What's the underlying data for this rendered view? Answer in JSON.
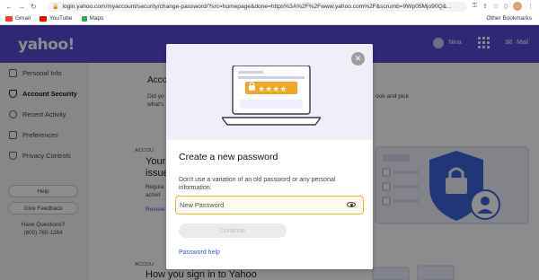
{
  "browser": {
    "url": "login.yahoo.com/myaccount/security/change-password/?src=homepage&done=https%3A%2F%2Fwww.yahoo.com%2F&scrumb=9Wp05Mjo90Q&..."
  },
  "bookmarks": {
    "items": [
      "Gmail",
      "YouTube",
      "Maps"
    ],
    "other": "Other Bookmarks"
  },
  "header": {
    "logo": "yahoo!",
    "user": "Nina",
    "mail": "Mail"
  },
  "sidebar": {
    "items": [
      {
        "label": "Personal Info",
        "active": false
      },
      {
        "label": "Account Security",
        "active": true
      },
      {
        "label": "Recent Activity",
        "active": false
      },
      {
        "label": "Preferences",
        "active": false
      },
      {
        "label": "Privacy Controls",
        "active": false
      }
    ],
    "help": "Help",
    "feedback": "Give Feedback",
    "questions": "Have Questions?",
    "phone": "(800) 760-1284"
  },
  "background": {
    "heading": "Accoun",
    "line1": "Did yo",
    "line1b": "ook and pick",
    "line2": "what's",
    "section_label": "ACCOU",
    "card_heading1": "Your",
    "card_heading2": "issue",
    "card_text1": "Regula",
    "card_text2": "activit",
    "review": "Review",
    "bottom_label": "ACCOU",
    "bottom_heading": "How you sign in to Yahoo"
  },
  "modal": {
    "stars": "★★★★",
    "title": "Create a new password",
    "description": "Don't use a variation of an old password or any personal information.",
    "input_placeholder": "New Password",
    "continue_label": "Continue",
    "help_link": "Password help"
  },
  "colors": {
    "header": "#5a4ad6",
    "accent": "#f0b629",
    "link": "#3c5ae5"
  }
}
